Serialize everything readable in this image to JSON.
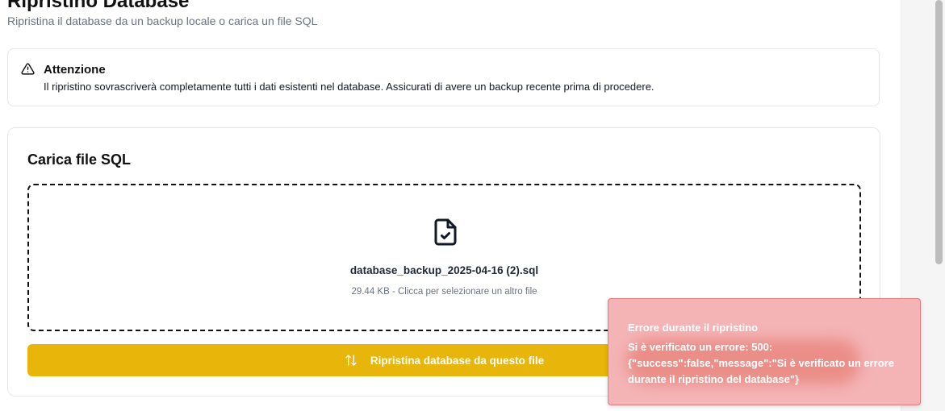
{
  "header": {
    "title": "Ripristino Database",
    "subtitle": "Ripristina il database da un backup locale o carica un file SQL"
  },
  "alert": {
    "icon": "warning-triangle-icon",
    "title": "Attenzione",
    "text": "Il ripristino sovrascriverà completamente tutti i dati esistenti nel database. Assicurati di avere un backup recente prima di procedere."
  },
  "upload": {
    "title": "Carica file SQL",
    "file_icon": "file-check-icon",
    "file_name": "database_backup_2025-04-16 (2).sql",
    "file_meta": "29.44 KB - Clicca per selezionare un altro file",
    "button_icon": "arrows-up-down-icon",
    "button_label": "Ripristina database da questo file",
    "button_color": "#e8b50a"
  },
  "toast": {
    "title": "Errore durante il ripristino",
    "message_line1": "Si è verificato un errore: 500:",
    "message_line2": "{\"success\":false,\"message\":\"Si è verificato un errore",
    "message_line3": "durante il ripristino del database\"}",
    "background": "#f4b3b5"
  }
}
